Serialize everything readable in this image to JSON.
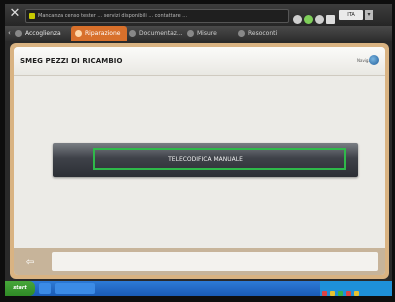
{
  "status_bar": {
    "message": "Mancanza censo tester ... servizi disponibili ... contattare ...",
    "language_value": "ITA"
  },
  "tabs": [
    {
      "label": "Accoglienza",
      "active": false
    },
    {
      "label": "Riparazione",
      "active": true
    },
    {
      "label": "Documentaz...",
      "active": false
    },
    {
      "label": "Misure",
      "active": false
    },
    {
      "label": "Resoconti",
      "active": false
    }
  ],
  "page": {
    "title": "SMEG  PEZZI DI RICAMBIO",
    "help_label": "Navigation"
  },
  "main": {
    "manual_button_label": "TELECODIFICA MANUALE",
    "highlight_color": "#2fb94a"
  },
  "footer": {
    "back_icon": "arrow-left-icon",
    "field_value": ""
  },
  "taskbar": {
    "start_label": "start"
  },
  "colors": {
    "accent_tab": "#d8702b",
    "panel_frame": "#d9b382"
  }
}
